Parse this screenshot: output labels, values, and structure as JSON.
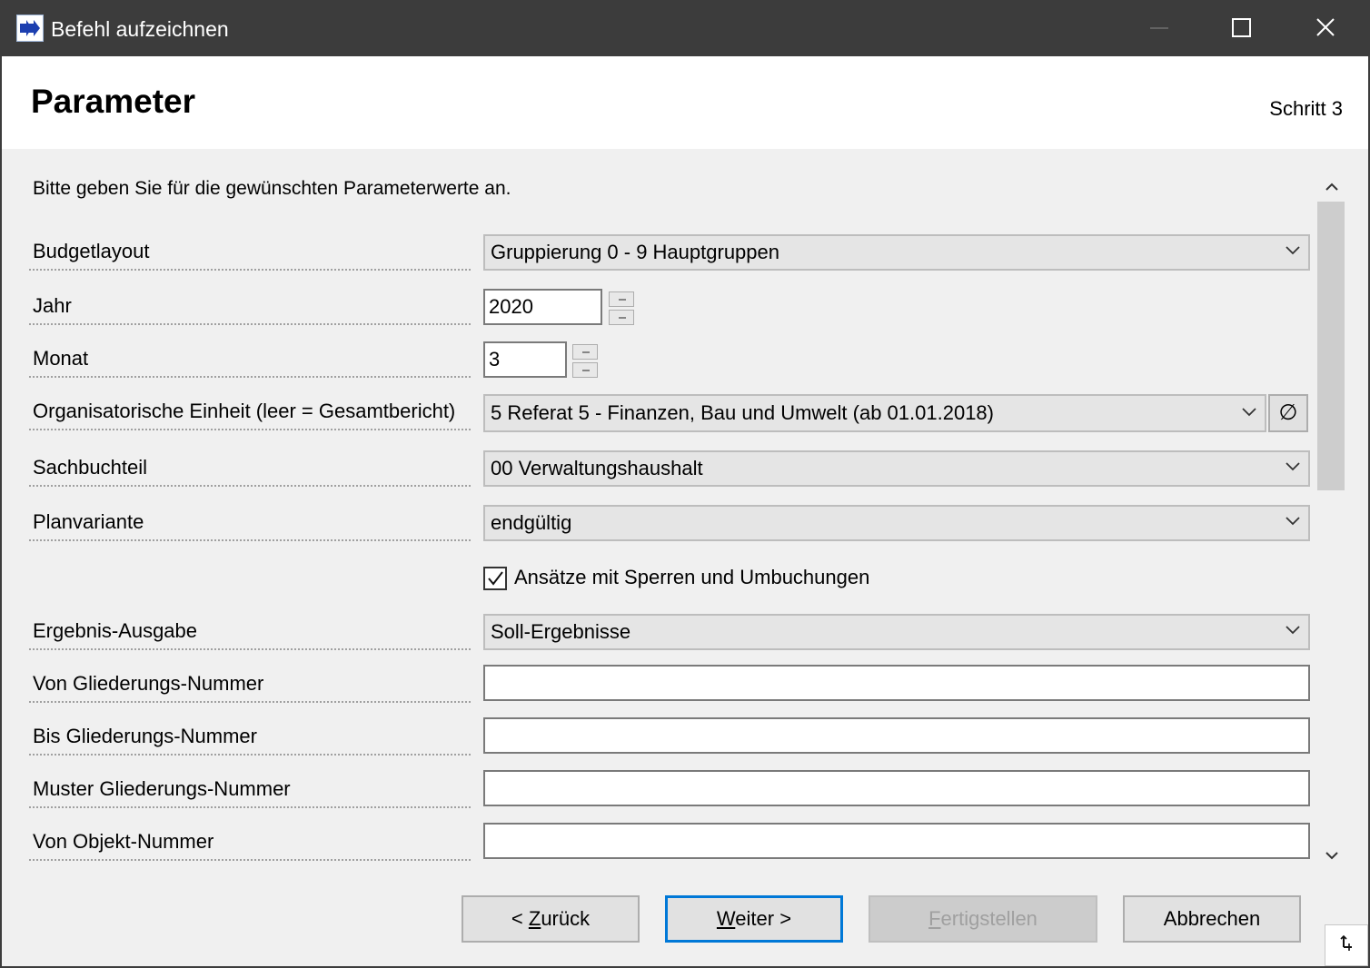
{
  "window": {
    "title": "Befehl aufzeichnen"
  },
  "header": {
    "title": "Parameter",
    "step": "Schritt 3"
  },
  "instruction": "Bitte geben Sie für die gewünschten Parameterwerte an.",
  "fields": {
    "budgetlayout": {
      "label": "Budgetlayout",
      "value": "Gruppierung 0 - 9 Hauptgruppen"
    },
    "jahr": {
      "label": "Jahr",
      "value": "2020"
    },
    "monat": {
      "label": "Monat",
      "value": "3"
    },
    "org_einheit": {
      "label": "Organisatorische Einheit (leer = Gesamtbericht)",
      "value": "5 Referat 5 - Finanzen, Bau und Umwelt (ab 01.01.2018)",
      "clear_symbol": "∅"
    },
    "sachbuchteil": {
      "label": "Sachbuchteil",
      "value": "00 Verwaltungshaushalt"
    },
    "planvariante": {
      "label": "Planvariante",
      "value": "endgültig"
    },
    "ansaetze": {
      "label": "Ansätze mit Sperren und Umbuchungen",
      "checked": true
    },
    "ergebnis_ausgabe": {
      "label": "Ergebnis-Ausgabe",
      "value": "Soll-Ergebnisse"
    },
    "von_gliederung": {
      "label": "Von Gliederungs-Nummer",
      "value": ""
    },
    "bis_gliederung": {
      "label": "Bis Gliederungs-Nummer",
      "value": ""
    },
    "muster_gliederung": {
      "label": "Muster Gliederungs-Nummer",
      "value": ""
    },
    "von_objekt": {
      "label": "Von Objekt-Nummer",
      "value": ""
    }
  },
  "buttons": {
    "back": {
      "prefix": "< ",
      "mnemonic": "Z",
      "rest": "urück"
    },
    "next": {
      "mnemonic": "W",
      "rest": "eiter >"
    },
    "finish": {
      "mnemonic": "F",
      "rest": "ertigstellen"
    },
    "cancel": {
      "label": "Abbrechen"
    }
  },
  "colors": {
    "titlebar": "#3c3c3c",
    "accent": "#0078d7",
    "dialog_bg": "#f0f0f0"
  }
}
